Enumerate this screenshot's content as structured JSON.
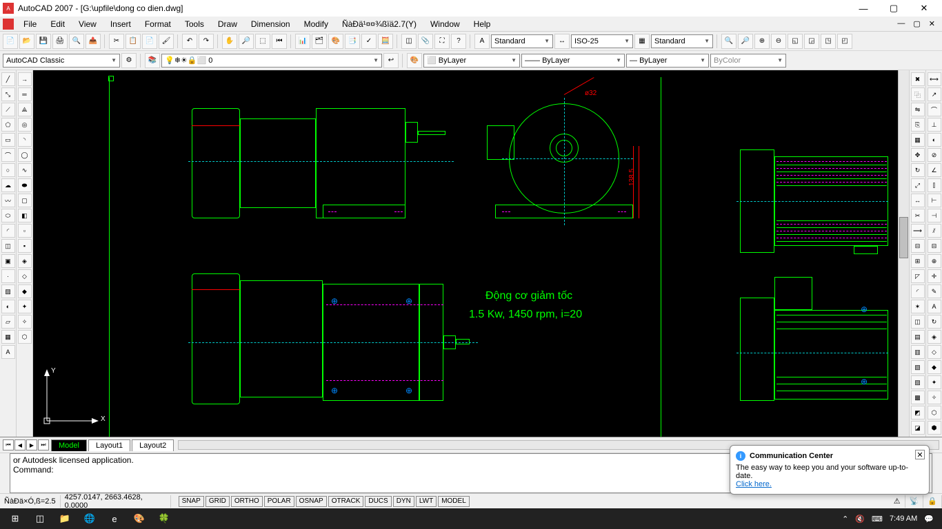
{
  "titlebar": {
    "app": "AutoCAD 2007",
    "file": "[G:\\upfile\\dong co dien.dwg]"
  },
  "menu": [
    "File",
    "Edit",
    "View",
    "Insert",
    "Format",
    "Tools",
    "Draw",
    "Dimension",
    "Modify",
    "ÑàÐä¹¤¤¾ßïä2.7(Y)",
    "Window",
    "Help"
  ],
  "tb1": {
    "textstyle": "Standard",
    "dimstyle": "ISO-25",
    "tablestyle": "Standard"
  },
  "tb2": {
    "workspace": "AutoCAD Classic",
    "layer": "0",
    "linetype_combo": "ByLayer",
    "lineweight_combo": "ByLayer",
    "plotstyle_combo": "ByLayer",
    "color_combo": "ByColor"
  },
  "canvas": {
    "text1": "Động cơ giảm tốc",
    "text2": "1.5 Kw, 1450 rpm, i=20",
    "dim1": "ø32",
    "dim2": "138.5",
    "ucs_x": "X",
    "ucs_y": "Y"
  },
  "tabs": {
    "model": "Model",
    "l1": "Layout1",
    "l2": "Layout2"
  },
  "cmd": {
    "line1": "or Autodesk licensed application.",
    "line2": "",
    "prompt": "Command:"
  },
  "status": {
    "left": "ÑàÐä×Ó,ß=2.5",
    "coords": "4257.0147, 2663.4628, 0.0000",
    "toggles": [
      "SNAP",
      "GRID",
      "ORTHO",
      "POLAR",
      "OSNAP",
      "OTRACK",
      "DUCS",
      "DYN",
      "LWT",
      "MODEL"
    ]
  },
  "balloon": {
    "title": "Communication Center",
    "body": "The easy way to keep you and your software up-to-date.",
    "link": "Click here."
  },
  "tray": {
    "time": "7:49 AM"
  }
}
